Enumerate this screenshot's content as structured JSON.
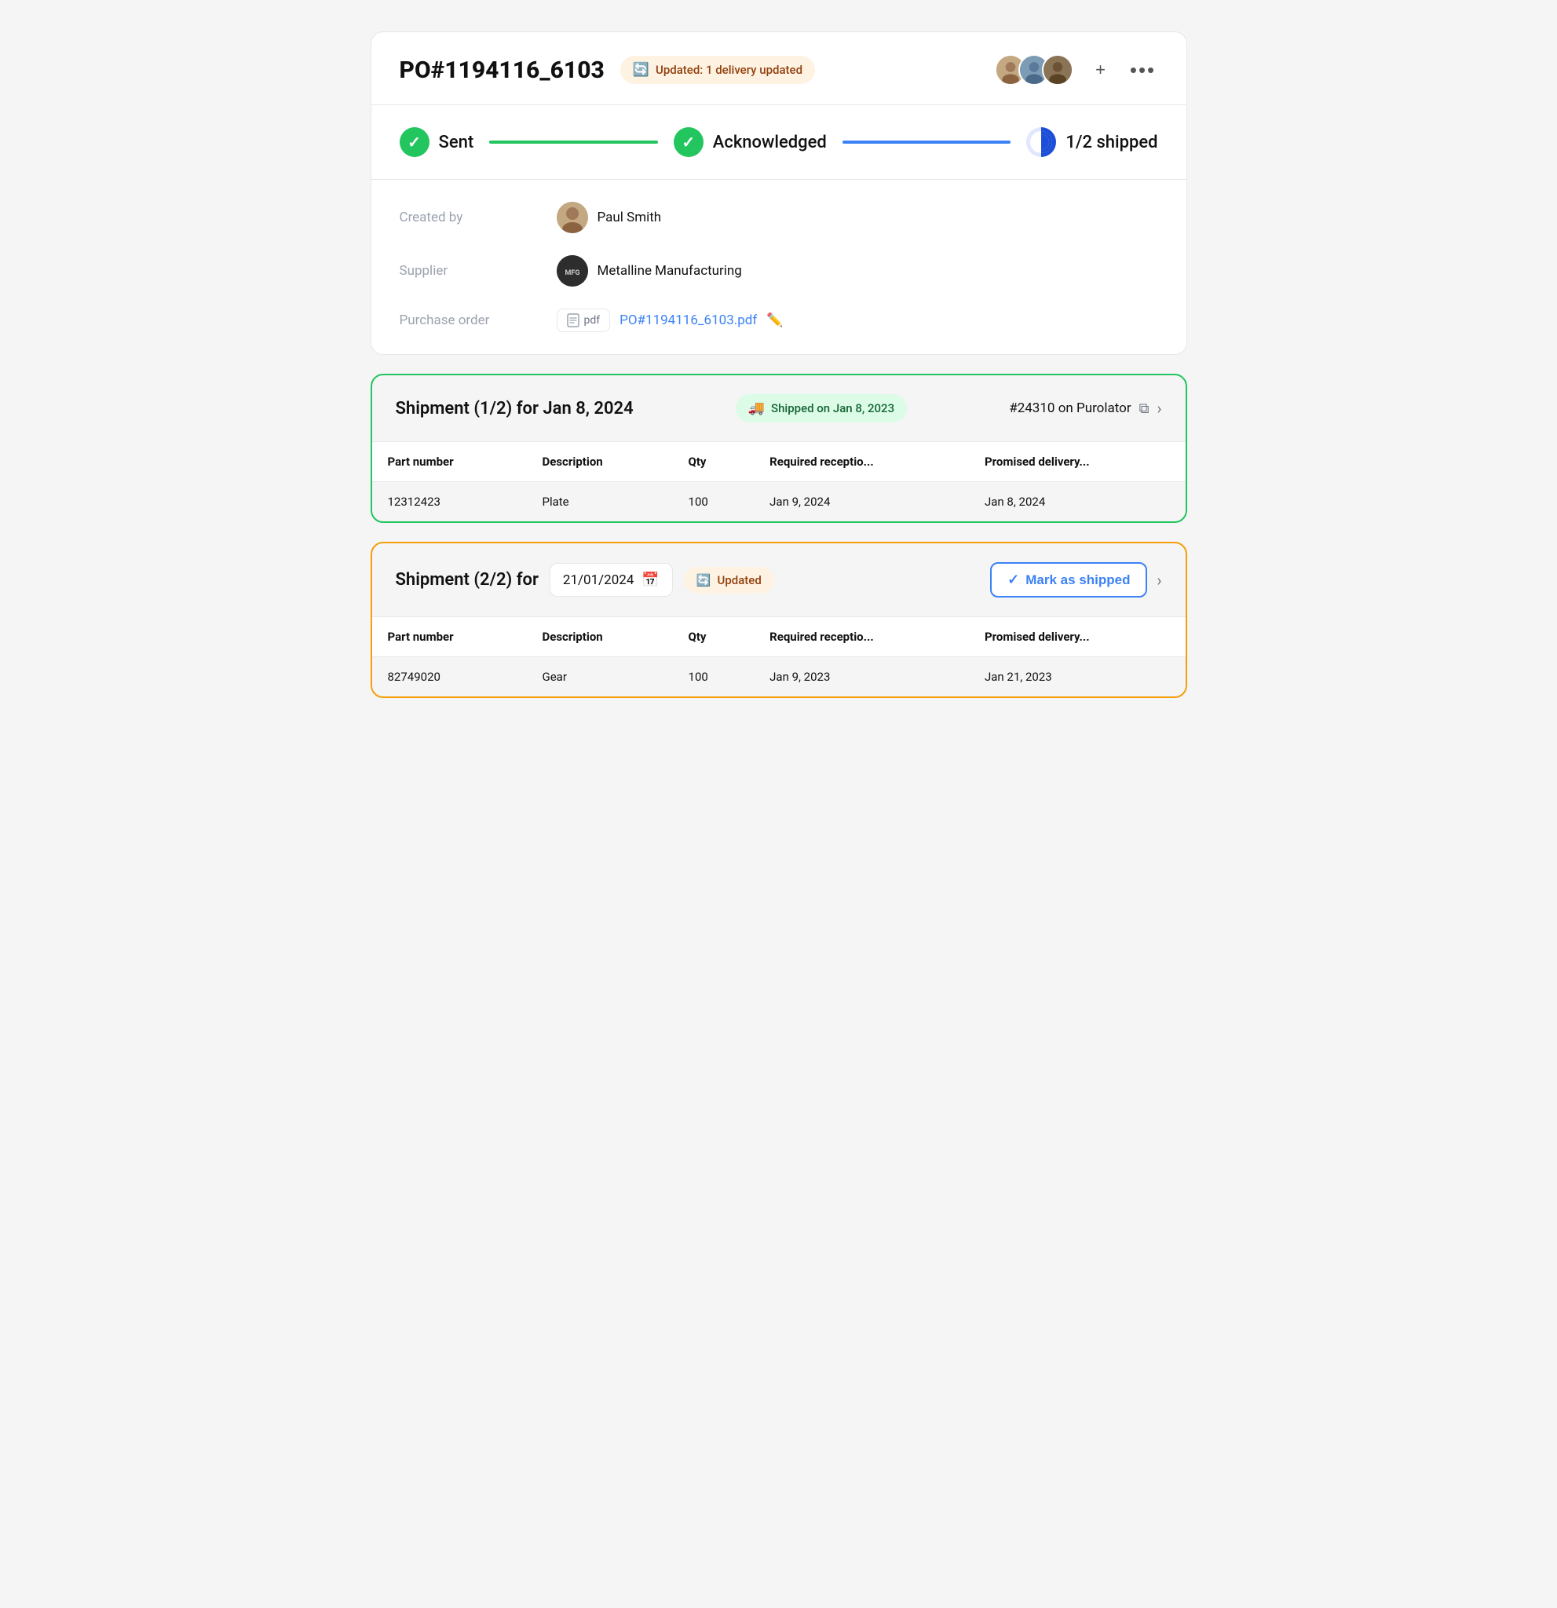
{
  "header": {
    "po_title": "PO#1194116_6103",
    "update_badge": "Updated: 1 delivery updated",
    "avatars": [
      {
        "id": "avatar-1",
        "label": "User 1"
      },
      {
        "id": "avatar-2",
        "label": "User 2"
      },
      {
        "id": "avatar-3",
        "label": "User 3"
      }
    ],
    "add_user_label": "+",
    "more_options_label": "···"
  },
  "status_bar": {
    "sent_label": "Sent",
    "acknowledged_label": "Acknowledged",
    "shipped_label": "1/2 shipped"
  },
  "details": {
    "created_by_label": "Created by",
    "created_by_value": "Paul Smith",
    "supplier_label": "Supplier",
    "supplier_value": "Metalline Manufacturing",
    "purchase_order_label": "Purchase order",
    "pdf_label": "pdf",
    "pdf_filename": "PO#1194116_6103.pdf"
  },
  "shipment1": {
    "title": "Shipment (1/2) for Jan 8, 2024",
    "shipped_badge": "Shipped on Jan 8, 2023",
    "reference": "#24310 on Purolator",
    "columns": [
      "Part number",
      "Description",
      "Qty",
      "Required receptio...",
      "Promised delivery..."
    ],
    "rows": [
      {
        "part_number": "12312423",
        "description": "Plate",
        "qty": "100",
        "required_reception": "Jan 9, 2024",
        "promised_delivery": "Jan 8, 2024"
      }
    ]
  },
  "shipment2": {
    "title": "Shipment (2/2) for",
    "date_value": "21/01/2024",
    "updated_badge": "Updated",
    "mark_shipped_label": "Mark as shipped",
    "columns": [
      "Part number",
      "Description",
      "Qty",
      "Required receptio...",
      "Promised delivery..."
    ],
    "rows": [
      {
        "part_number": "82749020",
        "description": "Gear",
        "qty": "100",
        "required_reception": "Jan 9, 2023",
        "promised_delivery": "Jan 21, 2023"
      }
    ]
  }
}
